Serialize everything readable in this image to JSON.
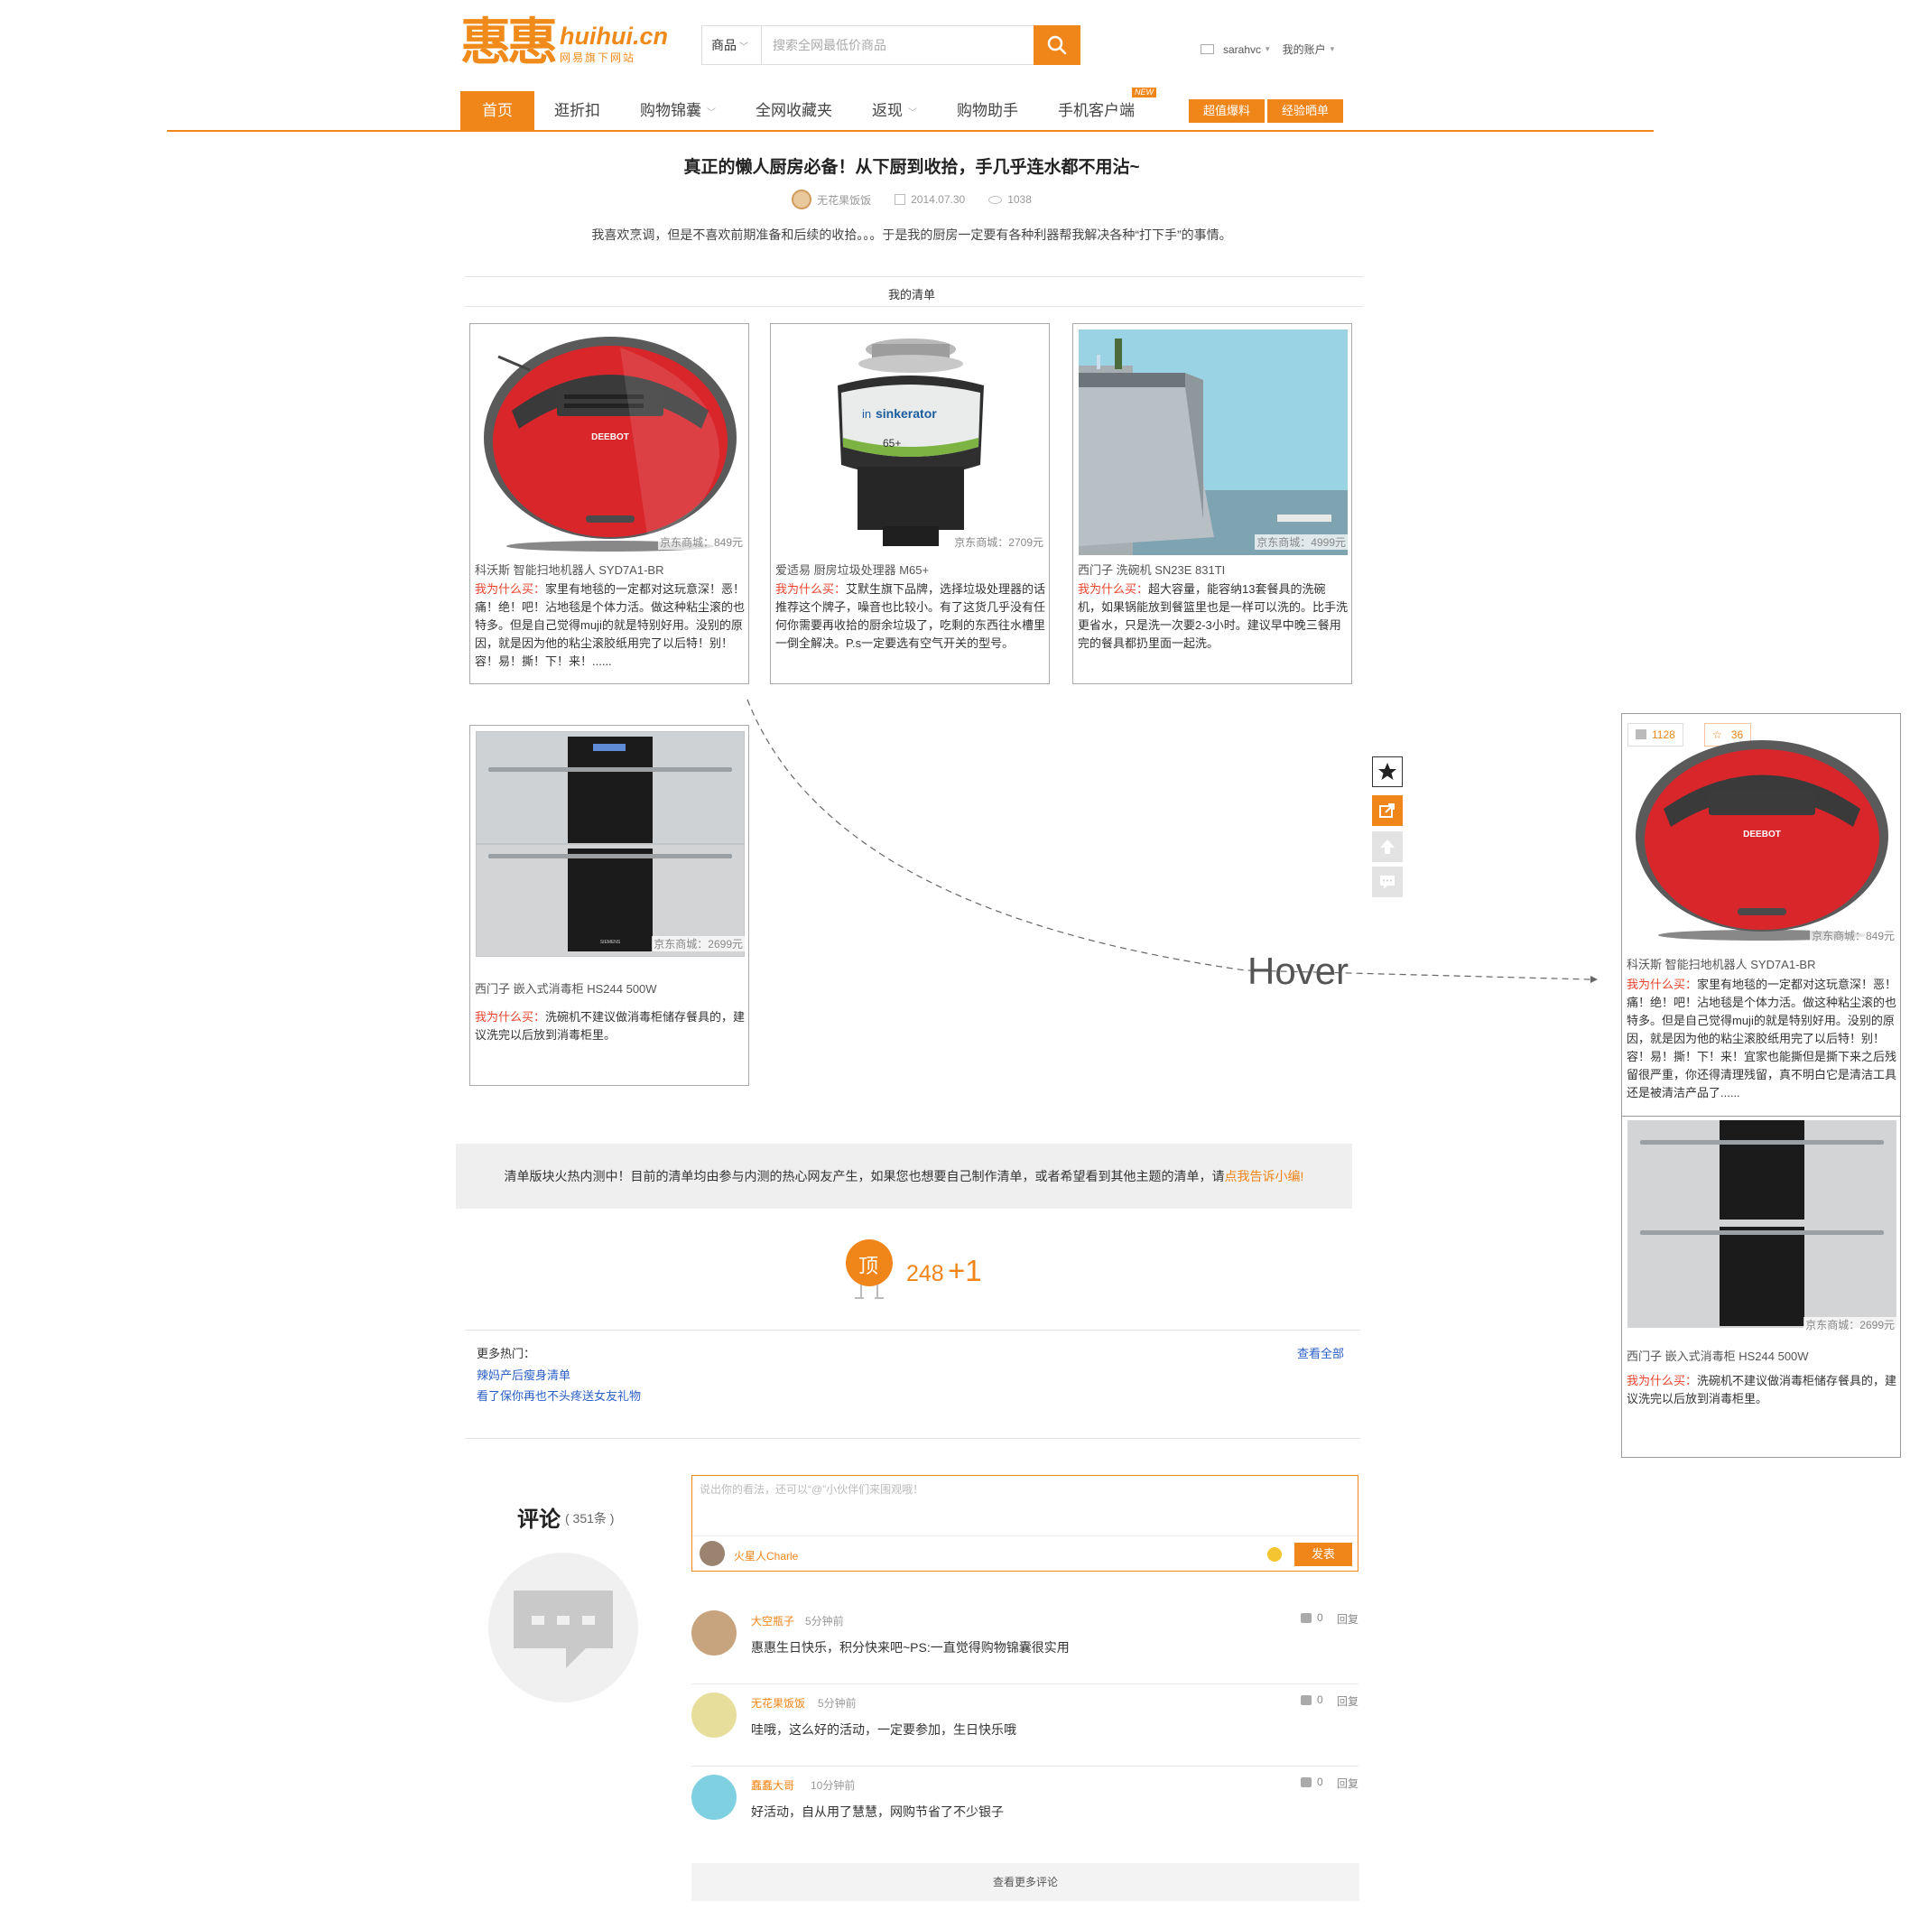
{
  "header": {
    "logo_text": "惠惠",
    "logo_domain": "huihui.cn",
    "logo_sub": "网易旗下网站",
    "search_category": "商品",
    "search_placeholder": "搜索全网最低价商品",
    "username": "sarahvc",
    "account_label": "我的账户"
  },
  "nav": {
    "items": [
      {
        "label": "首页"
      },
      {
        "label": "逛折扣"
      },
      {
        "label": "购物锦囊"
      },
      {
        "label": "全网收藏夹"
      },
      {
        "label": "返现"
      },
      {
        "label": "购物助手"
      },
      {
        "label": "手机客户端"
      }
    ],
    "new_badge": "NEW",
    "buttons": [
      "超值爆料",
      "经验晒单"
    ]
  },
  "article": {
    "title": "真正的懒人厨房必备！从下厨到收拾，手几乎连水都不用沾~",
    "author": "无花果饭饭",
    "date": "2014.07.30",
    "views": "1038",
    "description": "我喜欢烹调，但是不喜欢前期准备和后续的收拾。。。于是我的厨房一定要有各种利器帮我解决各种“打下手”的事情。",
    "list_label": "我的清单"
  },
  "products": [
    {
      "price": "京东商城：849元",
      "name": "科沃斯   智能扫地机器人  SYD7A1-BR",
      "why_label": "我为什么买：",
      "reason": "家里有地毯的一定都对这玩意深！恶！痛！绝！吧！沾地毯是个体力活。做这种粘尘滚的也特多。但是自己觉得muji的就是特别好用。没别的原因，就是因为他的粘尘滚胶纸用完了以后特！别！容！易！撕！下！来！......"
    },
    {
      "price": "京东商城：2709元",
      "name": "爱适易   厨房垃圾处理器  M65+",
      "why_label": "我为什么买：",
      "reason": "艾默生旗下品牌，选择垃圾处理器的话推荐这个牌子，噪音也比较小。有了这货几乎没有任何你需要再收拾的厨余垃圾了，吃剩的东西往水槽里一倒全解决。P.s一定要选有空气开关的型号。"
    },
    {
      "price": "京东商城：4999元",
      "name": "西门子   洗碗机    SN23E  831TI",
      "why_label": "我为什么买：",
      "reason": "超大容量，能容纳13套餐具的洗碗机，如果锅能放到餐篮里也是一样可以洗的。比手洗更省水，只是洗一次要2-3小时。建议早中晚三餐用完的餐具都扔里面一起洗。"
    },
    {
      "price": "京东商城：2699元",
      "name": "西门子  嵌入式消毒柜    HS244   500W",
      "why_label": "我为什么买：",
      "reason": "洗碗机不建议做消毒柜储存餐具的，建议洗完以后放到消毒柜里。"
    }
  ],
  "notice": {
    "text": "清单版块火热内测中！目前的清单均由参与内测的热心网友产生，如果您也想要自己制作清单，或者希望看到其他主题的清单，请",
    "link": "点我告诉小编!"
  },
  "vote": {
    "label": "顶",
    "count": "248",
    "plus": "+1"
  },
  "more_hot": {
    "label": "更多热门：",
    "links": [
      "辣妈产后瘦身清单",
      "看了保你再也不头疼送女友礼物"
    ],
    "view_all": "查看全部"
  },
  "comments": {
    "title": "评论",
    "count": "( 351条 )",
    "input_placeholder": "说出你的看法，还可以“@”小伙伴们来围观哦！",
    "current_user": "火星人Charle",
    "send_label": "发表",
    "items": [
      {
        "name": "大空瓶子",
        "time": "5分钟前",
        "text": "惠惠生日快乐，积分快来吧~PS:一直觉得购物锦囊很实用",
        "likes": "0",
        "reply": "回复"
      },
      {
        "name": "无花果饭饭",
        "time": "5分钟前",
        "text": "哇哦，这么好的活动，一定要参加，生日快乐哦",
        "likes": "0",
        "reply": "回复"
      },
      {
        "name": "蠢蠢大哥",
        "time": "10分钟前",
        "text": "好活动，自从用了慧慧，网购节省了不少银子",
        "likes": "0",
        "reply": "回复"
      }
    ],
    "more_label": "查看更多评论"
  },
  "hover": {
    "label": "Hover",
    "likes": "1128",
    "stars": "36",
    "price": "京东商城：849元",
    "name": "科沃斯  智能扫地机器人  SYD7A1-BR",
    "why_label": "我为什么买：",
    "reason": "家里有地毯的一定都对这玩意深！恶！痛！绝！吧！沾地毯是个体力活。做这种粘尘滚的也特多。但是自己觉得muji的就是特别好用。没别的原因，就是因为他的粘尘滚胶纸用完了以后特！别！容！易！撕！下！来！宜家也能撕但是撕下来之后残留很严重，你还得清理残留，真不明白它是清洁工具还是被清洁产品了......",
    "price2": "京东商城：2699元",
    "name2": "西门子  嵌入式消毒柜    HS244   500W",
    "reason2": "洗碗机不建议做消毒柜储存餐具的，建议洗完以后放到消毒柜里。"
  },
  "colors": {
    "accent": "#f08519",
    "why_red": "#e8442b",
    "link_blue": "#2a5fc8"
  },
  "icons": [
    "search-icon",
    "mail-icon",
    "calendar-icon",
    "eye-icon",
    "star-icon",
    "share-icon",
    "arrow-up-icon",
    "comment-icon",
    "thumbs-up-icon",
    "emoji-icon"
  ]
}
